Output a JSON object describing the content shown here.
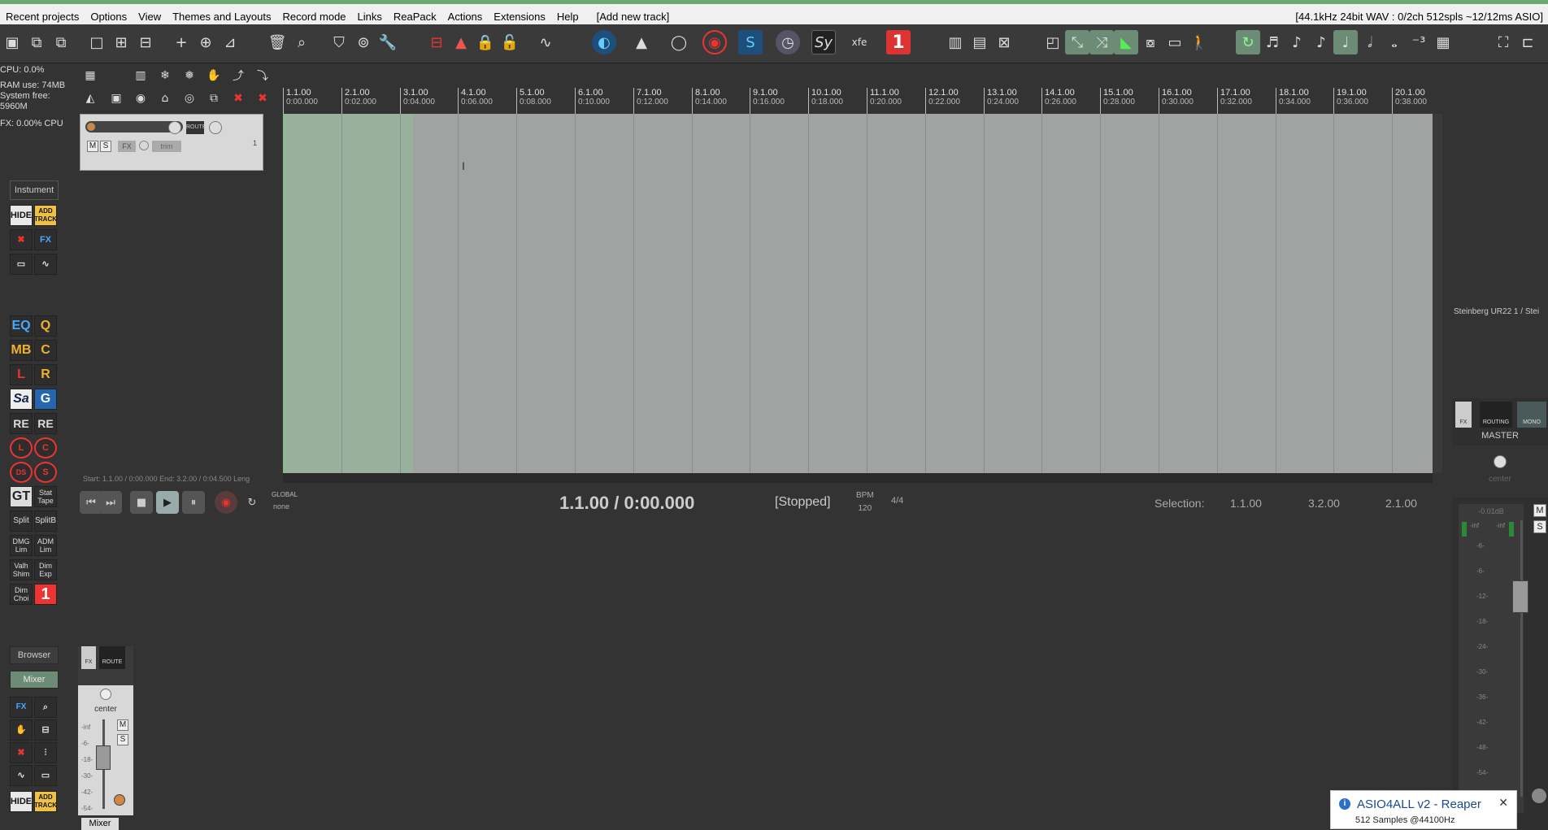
{
  "menubar": {
    "items": [
      "Recent projects",
      "Options",
      "View",
      "Themes and Layouts",
      "Record mode",
      "Links",
      "ReaPack",
      "Actions",
      "Extensions",
      "Help",
      "[Add new track]"
    ],
    "status": "[44.1kHz 24bit WAV : 0/2ch 512spls ~12/12ms ASIO]"
  },
  "info": {
    "cpu": "CPU: 0.0%",
    "ram": "RAM use: 74MB",
    "system_free": "System free: 5960M",
    "fx_cpu": "FX: 0.00% CPU"
  },
  "left_panel": {
    "instrument_label": "Instument",
    "hide_label": "HIDE",
    "add_track_label": "ADD TRACK",
    "plugins": [
      "EQ",
      "Q",
      "MB",
      "C",
      "L",
      "R",
      "Sa",
      "G",
      "RE",
      "RE",
      "GT",
      "Stat Tape",
      "Split",
      "SplitB",
      "DMG Lim",
      "ADM Lim",
      "Valh Shim",
      "Dim Exp",
      "Dim Choi",
      "1"
    ],
    "browser_label": "Browser",
    "mixer_label": "Mixer",
    "hide_label_2": "HIDE",
    "add_track_label_2": "ADD TRACK"
  },
  "track": {
    "mute": "M",
    "solo": "S",
    "fx": "FX",
    "trim": "trim",
    "route": "ROUTE",
    "number": "1"
  },
  "ruler": {
    "ticks": [
      {
        "bar": "1.1.00",
        "time": "0:00.000"
      },
      {
        "bar": "2.1.00",
        "time": "0:02.000"
      },
      {
        "bar": "3.1.00",
        "time": "0:04.000"
      },
      {
        "bar": "4.1.00",
        "time": "0:06.000"
      },
      {
        "bar": "5.1.00",
        "time": "0:08.000"
      },
      {
        "bar": "6.1.00",
        "time": "0:10.000"
      },
      {
        "bar": "7.1.00",
        "time": "0:12.000"
      },
      {
        "bar": "8.1.00",
        "time": "0:14.000"
      },
      {
        "bar": "9.1.00",
        "time": "0:16.000"
      },
      {
        "bar": "10.1.00",
        "time": "0:18.000"
      },
      {
        "bar": "11.1.00",
        "time": "0:20.000"
      },
      {
        "bar": "12.1.00",
        "time": "0:22.000"
      },
      {
        "bar": "13.1.00",
        "time": "0:24.000"
      },
      {
        "bar": "14.1.00",
        "time": "0:26.000"
      },
      {
        "bar": "15.1.00",
        "time": "0:28.000"
      },
      {
        "bar": "16.1.00",
        "time": "0:30.000"
      },
      {
        "bar": "17.1.00",
        "time": "0:32.000"
      },
      {
        "bar": "18.1.00",
        "time": "0:34.000"
      },
      {
        "bar": "19.1.00",
        "time": "0:36.000"
      },
      {
        "bar": "20.1.00",
        "time": "0:38.000"
      }
    ]
  },
  "transport": {
    "start_info": "Start: 1.1.00 / 0:00.000 End: 3.2.00 / 0:04.500 Leng",
    "global_label": "GLOBAL",
    "global_value": "none",
    "position": "1.1.00 / 0:00.000",
    "state": "[Stopped]",
    "bpm_label": "BPM",
    "bpm_value": "120",
    "time_sig": "4/4",
    "selection_label": "Selection:",
    "selection_start": "1.1.00",
    "selection_end": "3.2.00",
    "selection_length": "2.1.00"
  },
  "mixer_strip": {
    "fx": "FX",
    "route": "ROUTE",
    "pan": "center",
    "mute": "M",
    "solo": "S",
    "scale": [
      "-inf",
      "-6-",
      "-18-",
      "-30-",
      "-42-",
      "-54-"
    ],
    "tab": "Mixer"
  },
  "master": {
    "device": "Steinberg UR22 1 / Stei",
    "fx": "FX",
    "routing": "ROUTING",
    "mono": "MONO",
    "label": "MASTER",
    "pan": "center",
    "db": "-0.01dB",
    "inf_left": "-inf",
    "inf_right": "-inf",
    "mute": "M",
    "solo": "S",
    "scale": [
      "-6-",
      "-6-",
      "-12-",
      "-18-",
      "-24-",
      "-30-",
      "-36-",
      "-42-",
      "-48-",
      "-54-"
    ]
  },
  "notification": {
    "title": "ASIO4ALL v2 - Reaper",
    "subtitle": "512 Samples   @44100Hz"
  },
  "colors": {
    "selection": "#8cc896",
    "arrange_bg": "#a0a3a2",
    "accent": "#6c8c76"
  }
}
